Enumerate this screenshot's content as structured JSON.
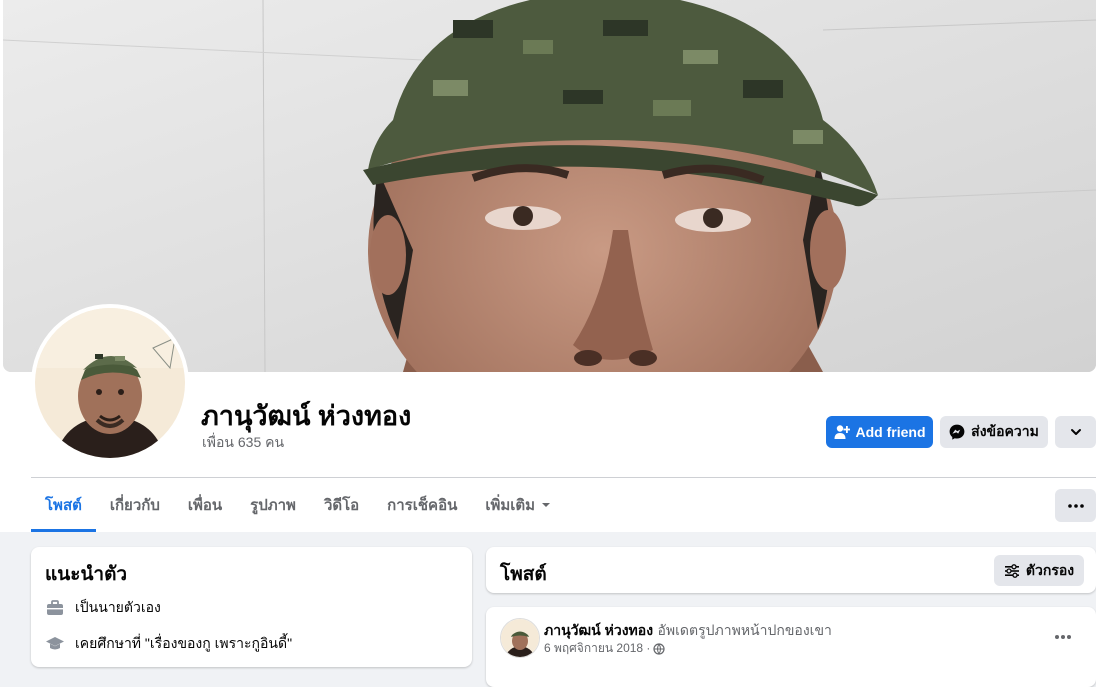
{
  "profile": {
    "name": "ภานุวัฒน์ ห่วงทอง",
    "friends": "เพื่อน 635 คน"
  },
  "actions": {
    "add_friend": "Add friend",
    "message": "ส่งข้อความ"
  },
  "tabs": [
    {
      "label": "โพสต์",
      "active": true
    },
    {
      "label": "เกี่ยวกับ"
    },
    {
      "label": "เพื่อน"
    },
    {
      "label": "รูปภาพ"
    },
    {
      "label": "วิดีโอ"
    },
    {
      "label": "การเช็คอิน"
    },
    {
      "label": "เพิ่มเติม"
    }
  ],
  "intro": {
    "title": "แนะนำตัว",
    "items": [
      {
        "icon": "briefcase-icon",
        "text": "เป็นนายตัวเอง"
      },
      {
        "icon": "graduation-cap-icon",
        "text": "เคยศึกษาที่ \"เรื่องของกู เพราะกูอินดี้\""
      }
    ]
  },
  "posts_section": {
    "title": "โพสต์",
    "filter_label": "ตัวกรอง"
  },
  "post": {
    "author": "ภานุวัฒน์ ห่วงทอง",
    "action": "อัพเดตรูปภาพหน้าปกของเขา",
    "date": "6 พฤศจิกายน 2018 ·"
  },
  "colors": {
    "brand_blue": "#1b74e4",
    "secondary_gray": "#e4e6eb",
    "page_bg": "#f0f2f5"
  }
}
